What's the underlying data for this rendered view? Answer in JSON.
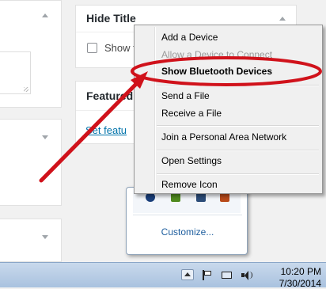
{
  "panels": {
    "hide_title": {
      "title": "Hide Title",
      "checkbox_label": "Show t"
    },
    "featured": {
      "title": "Featured",
      "link": "Set featu"
    }
  },
  "context_menu": {
    "items": [
      {
        "label": "Add a Device",
        "state": "enabled"
      },
      {
        "label": "Allow a Device to Connect",
        "state": "disabled"
      },
      {
        "label": "Show Bluetooth Devices",
        "state": "default"
      },
      {
        "label": "Send a File",
        "state": "enabled"
      },
      {
        "label": "Receive a File",
        "state": "enabled"
      },
      {
        "label": "Join a Personal Area Network",
        "state": "enabled"
      },
      {
        "label": "Open Settings",
        "state": "enabled"
      },
      {
        "label": "Remove Icon",
        "state": "enabled"
      }
    ]
  },
  "tray_popup": {
    "customize_label": "Customize...",
    "icons": [
      "bluetooth-icon",
      "network-app-icon",
      "settings-app-icon",
      "update-app-icon"
    ]
  },
  "taskbar": {
    "time": "10:20 PM",
    "date": "7/30/2014",
    "icons": [
      "show-hidden-icons-chevron-icon",
      "action-center-flag-icon",
      "network-icon",
      "volume-icon"
    ]
  },
  "annotation": {
    "highlight_color": "#d0121b"
  }
}
